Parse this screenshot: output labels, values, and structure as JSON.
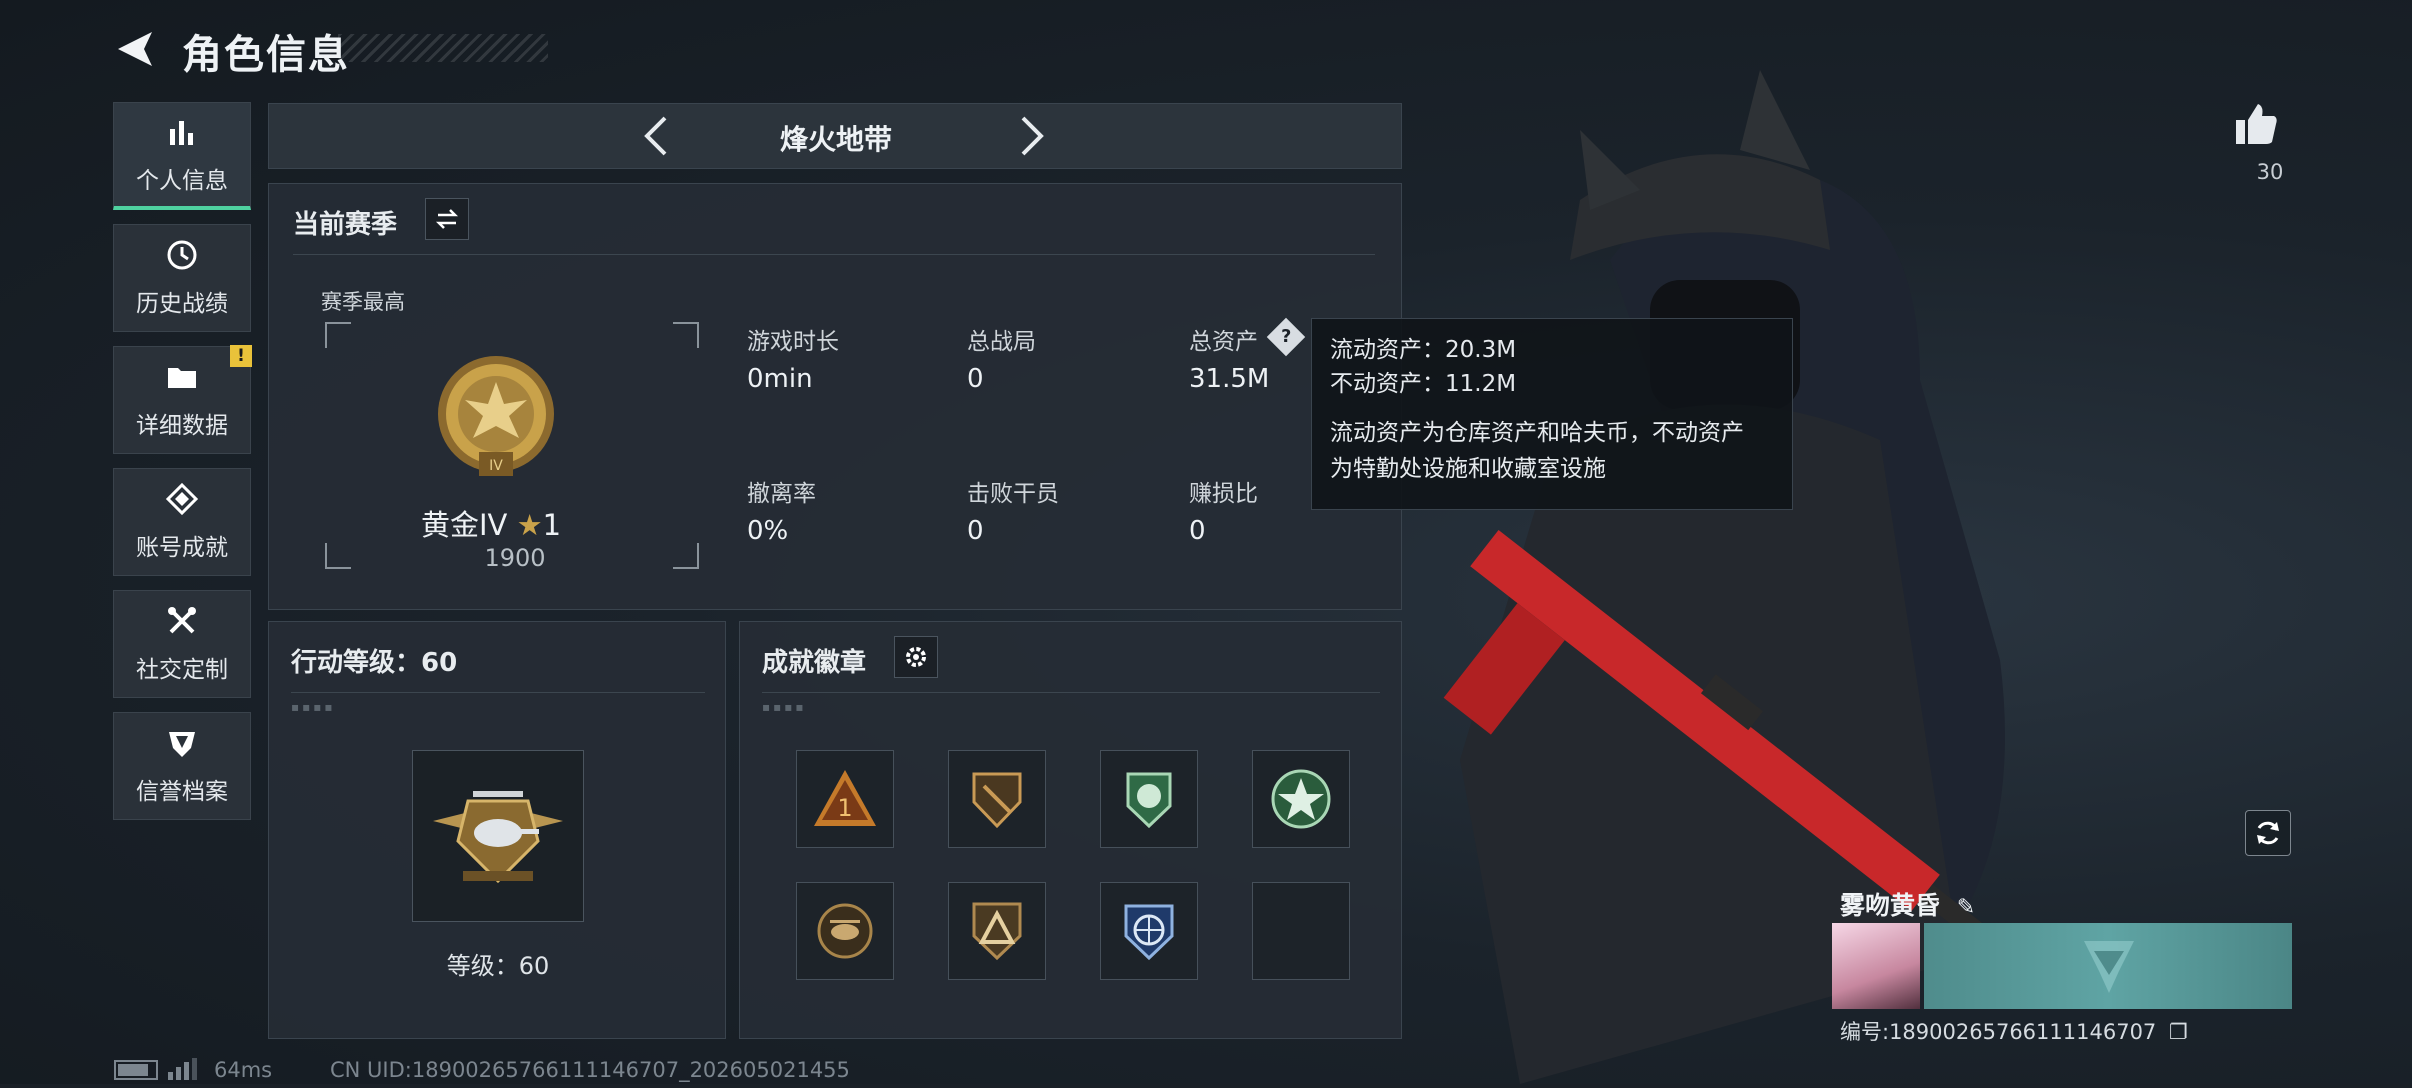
{
  "header": {
    "title": "角色信息"
  },
  "nav": [
    {
      "label": "个人信息",
      "icon": "bar-chart-icon",
      "active": true
    },
    {
      "label": "历史战绩",
      "icon": "history-clock-icon"
    },
    {
      "label": "详细数据",
      "icon": "folder-icon",
      "badge": "!"
    },
    {
      "label": "账号成就",
      "icon": "achievement-icon"
    },
    {
      "label": "社交定制",
      "icon": "tools-icon"
    },
    {
      "label": "信誉档案",
      "icon": "credit-shield-icon"
    }
  ],
  "mode": {
    "name": "烽火地带"
  },
  "season": {
    "title": "当前赛季",
    "best_label": "赛季最高",
    "rank_name": "黄金IV",
    "rank_stars": "1",
    "rank_score": "1900",
    "stats": [
      {
        "label": "游戏时长",
        "value": "0min"
      },
      {
        "label": "总战局",
        "value": "0"
      },
      {
        "label": "总资产",
        "value": "31.5M"
      },
      {
        "label": "撤离率",
        "value": "0%"
      },
      {
        "label": "击败干员",
        "value": "0"
      },
      {
        "label": "赚损比",
        "value": "0"
      }
    ]
  },
  "tooltip": {
    "liquid": "流动资产：20.3M",
    "fixed": "不动资产：11.2M",
    "desc_line1": "流动资产为仓库资产和哈夫币，不动资产",
    "desc_line2": "为特勤处设施和收藏室设施"
  },
  "action_level": {
    "title": "行动等级：60",
    "level_text": "等级：60"
  },
  "achievements": {
    "title": "成就徽章",
    "badges": [
      "triangle-1-badge",
      "shield-knife-badge",
      "green-crest-badge",
      "green-star-badge",
      "helicopter-badge",
      "triangle-a-badge",
      "blue-globe-badge",
      "empty-slot"
    ]
  },
  "likes": {
    "count": "30"
  },
  "player": {
    "name": "雾吻黄昏",
    "id_text": "编号:18900265766111146707"
  },
  "footer": {
    "ping": "64ms",
    "uid": "CN UID:18900265766111146707_202605021455"
  },
  "colors": {
    "accent": "#4fd2a0",
    "warning": "#e9c23a",
    "gold": "#c9a24a"
  }
}
